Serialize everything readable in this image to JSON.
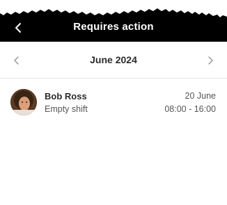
{
  "header": {
    "title": "Requires action",
    "back_icon": "chevron-left-icon",
    "background": "#000000",
    "text_color": "#ffffff"
  },
  "month_nav": {
    "label": "June 2024",
    "prev_icon": "chevron-left-icon",
    "next_icon": "chevron-right-icon"
  },
  "shifts": [
    {
      "name": "Bob Ross",
      "status": "Empty shift",
      "date": "20 June",
      "time": "08:00 - 16:00",
      "avatar": "avatar-photo"
    }
  ]
}
